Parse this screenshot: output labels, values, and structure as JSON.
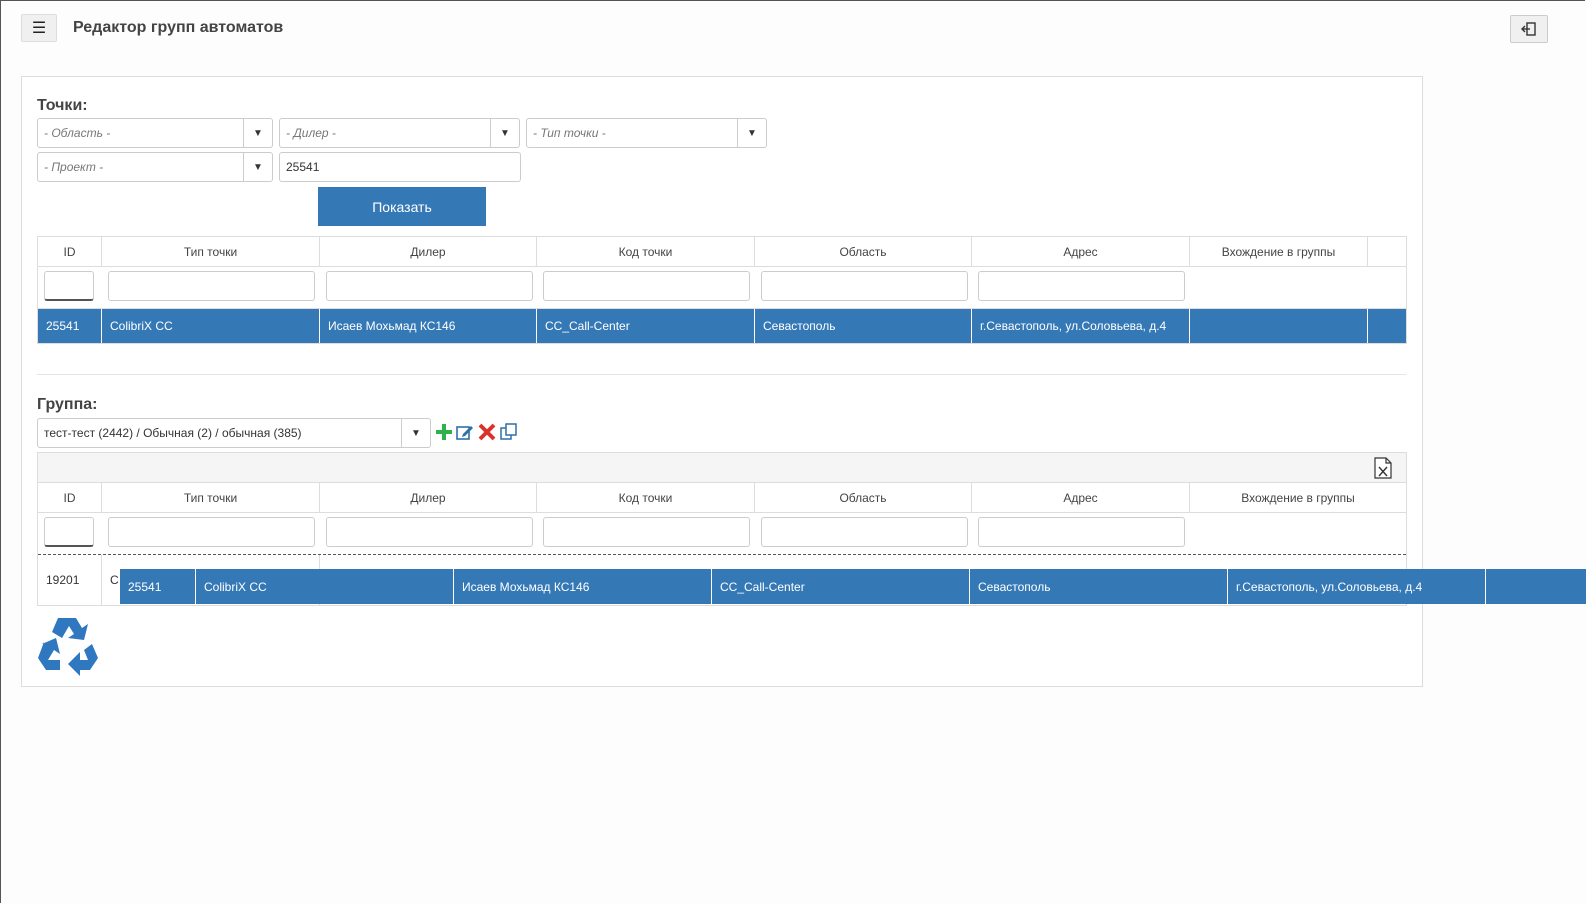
{
  "header": {
    "title": "Редактор групп автоматов"
  },
  "points": {
    "label": "Точки:",
    "filters": {
      "region_placeholder": "- Область -",
      "dealer_placeholder": "- Дилер -",
      "point_type_placeholder": "- Тип точки -",
      "project_placeholder": "- Проект -",
      "search_value": "25541"
    },
    "show_button": "Показать",
    "columns": [
      "ID",
      "Тип точки",
      "Дилер",
      "Код точки",
      "Область",
      "Адрес",
      "Вхождение в группы"
    ],
    "rows": [
      {
        "id": "25541",
        "type": "ColibriX CC",
        "dealer": "Исаев Мохьмад КС146",
        "code": "CC_Call-Center",
        "region": "Севастополь",
        "address": "г.Севастополь, ул.Соловьева, д.4",
        "groups": ""
      }
    ]
  },
  "group": {
    "label": "Группа:",
    "selected": "тест-тест (2442) / Обычная (2) / обычная (385)",
    "columns": [
      "ID",
      "Тип точки",
      "Дилер",
      "Код точки",
      "Область",
      "Адрес",
      "Вхождение в группы"
    ],
    "rows": [
      {
        "id": "19201",
        "type": "C"
      }
    ],
    "drag_row": {
      "id": "25541",
      "type": "ColibriX CC",
      "dealer": "Исаев Мохьмад КС146",
      "code": "CC_Call-Center",
      "region": "Севастополь",
      "address": "г.Севастополь, ул.Соловьева, д.4"
    }
  },
  "colors": {
    "accent": "#3578b6",
    "add": "#2db34a",
    "delete": "#d9342b"
  },
  "icons": {
    "menu": "menu-icon",
    "exit": "exit-icon",
    "add": "plus-icon",
    "edit": "edit-icon",
    "delete": "delete-icon",
    "copy": "copy-icon",
    "excel": "excel-export-icon",
    "recycle": "recycle-icon"
  }
}
